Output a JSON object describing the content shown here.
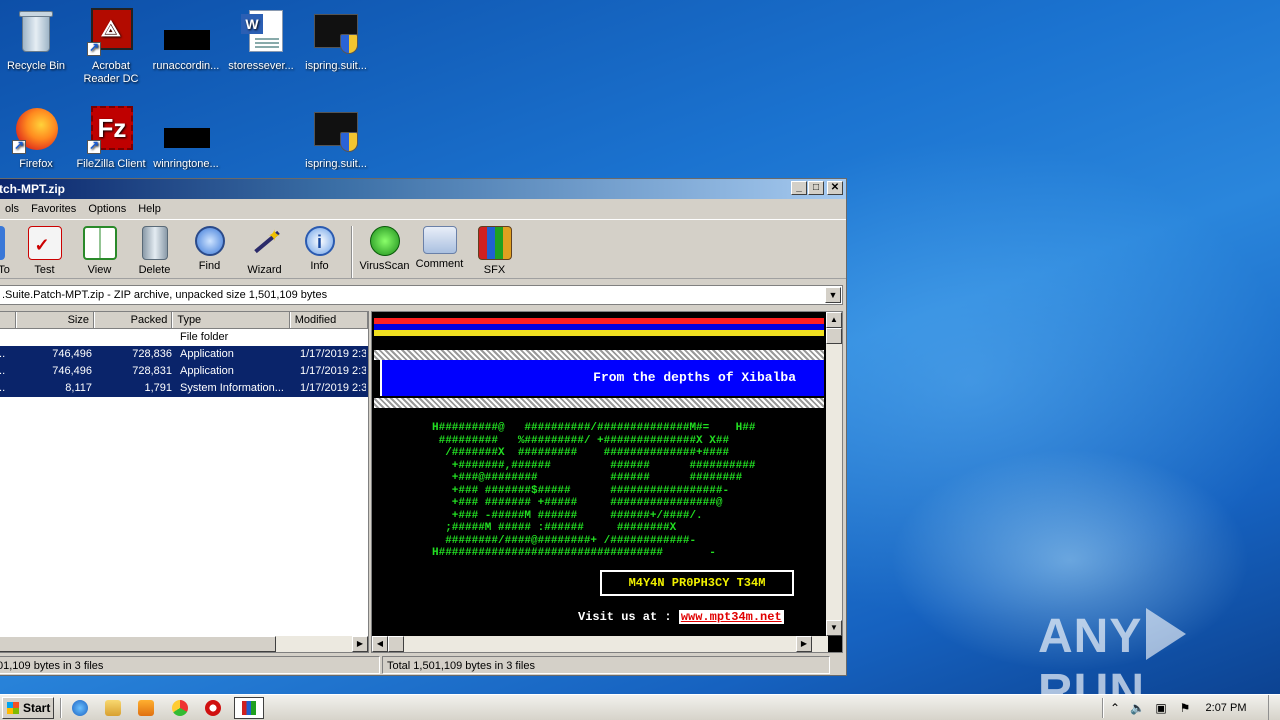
{
  "desktop": {
    "icons": [
      {
        "label": "Recycle Bin",
        "icon": "recycle-bin-icon"
      },
      {
        "label": "Acrobat Reader DC",
        "icon": "acrobat-icon"
      },
      {
        "label": "runaccordin...",
        "icon": "black-file-icon"
      },
      {
        "label": "storessever...",
        "icon": "word-doc-icon"
      },
      {
        "label": "ispring.suit...",
        "icon": "mpt-exe-icon"
      },
      {
        "label": "Firefox",
        "icon": "firefox-icon"
      },
      {
        "label": "FileZilla Client",
        "icon": "filezilla-icon"
      },
      {
        "label": "winringtone...",
        "icon": "black-file-icon"
      },
      {
        "label": "ispring.suit...",
        "icon": "mpt-exe-icon"
      }
    ]
  },
  "window": {
    "title": "tch-MPT.zip",
    "menu": [
      "ols",
      "Favorites",
      "Options",
      "Help"
    ],
    "toolbar": [
      {
        "label": "To",
        "icon": "to-icon"
      },
      {
        "label": "Test",
        "icon": "test-icon"
      },
      {
        "label": "View",
        "icon": "view-icon"
      },
      {
        "label": "Delete",
        "icon": "delete-icon"
      },
      {
        "label": "Find",
        "icon": "find-icon"
      },
      {
        "label": "Wizard",
        "icon": "wizard-icon"
      },
      {
        "label": "Info",
        "icon": "info-icon"
      },
      {
        "label": "VirusScan",
        "icon": "virusscan-icon"
      },
      {
        "label": "Comment",
        "icon": "comment-icon"
      },
      {
        "label": "SFX",
        "icon": "sfx-icon"
      }
    ],
    "address": ".Suite.Patch-MPT.zip - ZIP archive, unpacked size 1,501,109 bytes",
    "columns": [
      "",
      "Size",
      "Packed",
      "Type",
      "Modified"
    ],
    "rows": [
      {
        "name": "",
        "size": "",
        "packed": "",
        "type": "File folder",
        "modified": ""
      },
      {
        "name": "...",
        "size": "746,496",
        "packed": "728,836",
        "type": "Application",
        "modified": "1/17/2019 2:3"
      },
      {
        "name": "...",
        "size": "746,496",
        "packed": "728,831",
        "type": "Application",
        "modified": "1/17/2019 2:3"
      },
      {
        "name": "...",
        "size": "8,117",
        "packed": "1,791",
        "type": "System Information...",
        "modified": "1/17/2019 2:3"
      }
    ],
    "status_left": "01,109 bytes in 3 files",
    "status_right": "Total 1,501,109 bytes in 3 files"
  },
  "preview": {
    "banner": "From the depths of Xibalba",
    "ascii_art": "H#########@   ##########/##############M#=    H##\n #########   %#########/ +##############X X##\n  /#######X  #########    ##############+####\n   +#######,######         ######      ##########\n   +###@########           ######      ########\n   +### #######$#####      #################-\n   +### ####### +#####     ################@\n   +### -#####M ######     ######+/####/.\n  ;#####M ##### :######     ########X\n  ########/####@########+ /############-\nH##################################       -",
    "crew": "M4Y4N PR0PH3CY T34M",
    "visit_label": "Visit us at :",
    "url": "www.mpt34m.net"
  },
  "taskbar": {
    "start": "Start",
    "clock": "2:07 PM"
  },
  "watermark": {
    "left": "ANY",
    "right": "RUN"
  }
}
